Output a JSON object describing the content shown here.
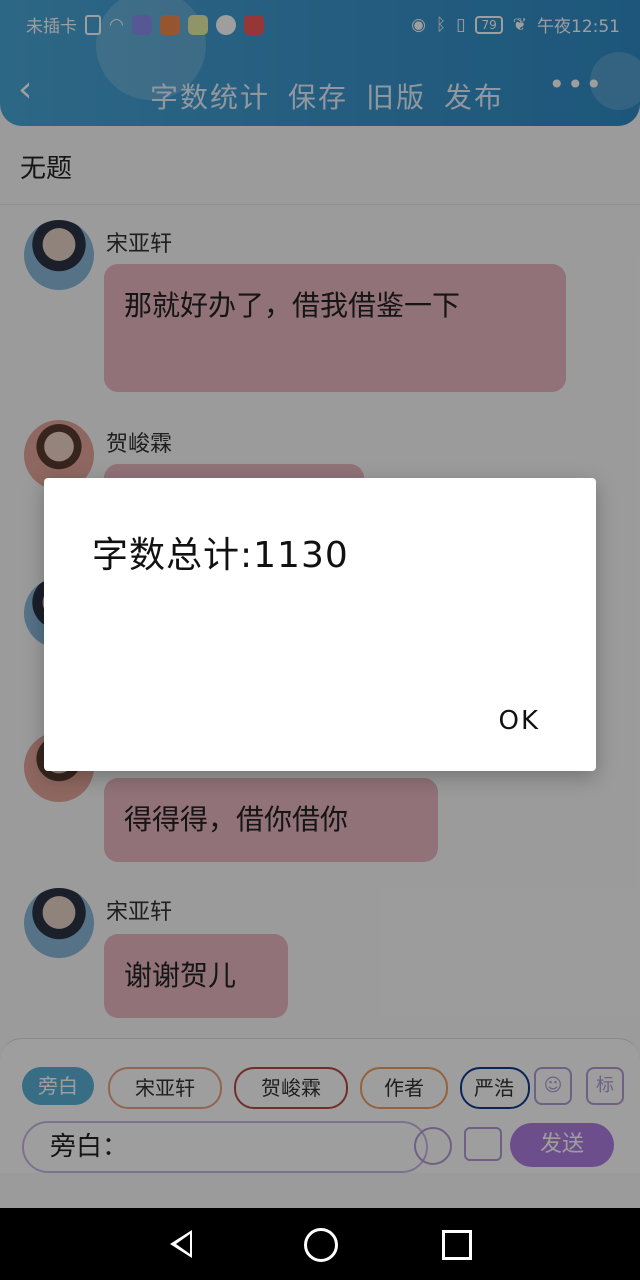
{
  "status_bar": {
    "carrier": "未插卡",
    "battery": "79",
    "time": "午夜12:51"
  },
  "header": {
    "actions": [
      "字数统计",
      "保存",
      "旧版",
      "发布"
    ],
    "more": "•••"
  },
  "topic": "无题",
  "messages": [
    {
      "speaker": "宋亚轩",
      "text": "那就好办了，借我借鉴一下"
    },
    {
      "speaker": "贺峻霖",
      "text": ""
    },
    {
      "speaker": "",
      "text": ""
    },
    {
      "speaker": "",
      "text": "得得得，借你借你"
    },
    {
      "speaker": "宋亚轩",
      "text": "谢谢贺儿"
    }
  ],
  "composer": {
    "chips": [
      "旁白",
      "宋亚轩",
      "贺峻霖",
      "作者",
      "严浩"
    ],
    "input_value": "旁白：",
    "send": "发送",
    "mark_icon_label": "标"
  },
  "dialog": {
    "message": "字数总计:1130",
    "ok": "OK"
  },
  "colors": {
    "header": "#3d98cf",
    "bubble": "#e9b8c2",
    "send": "#b07fe3"
  }
}
